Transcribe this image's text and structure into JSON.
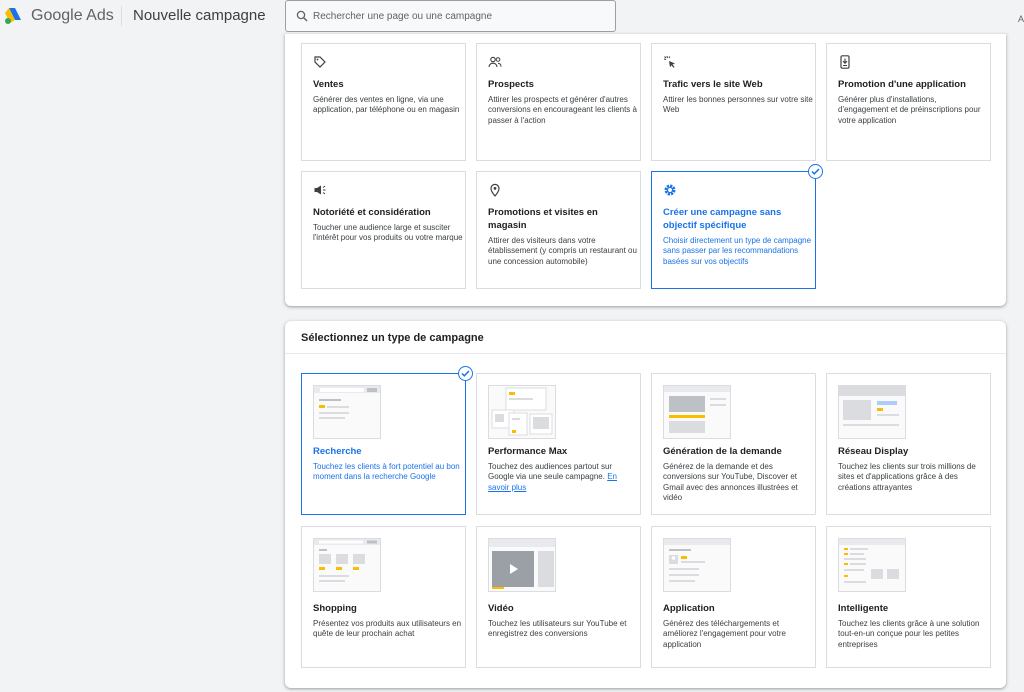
{
  "header": {
    "brand": "Google Ads",
    "page_title": "Nouvelle campagne",
    "search_placeholder": "Rechercher une page ou une campagne",
    "corner_letter": "A"
  },
  "objectives": [
    {
      "icon": "tag-icon",
      "title": "Ventes",
      "desc": "Générer des ventes en ligne, via une application, par téléphone ou en magasin",
      "selected": false
    },
    {
      "icon": "people-icon",
      "title": "Prospects",
      "desc": "Attirer les prospects et générer d'autres conversions en encourageant les clients à passer à l'action",
      "selected": false
    },
    {
      "icon": "cursor-click-icon",
      "title": "Trafic vers le site Web",
      "desc": "Attirer les bonnes personnes sur votre site Web",
      "selected": false
    },
    {
      "icon": "phone-download-icon",
      "title": "Promotion d'une application",
      "desc": "Générer plus d'installations, d'engagement et de préinscriptions pour votre application",
      "selected": false
    },
    {
      "icon": "megaphone-icon",
      "title": "Notoriété et considération",
      "desc": "Toucher une audience large et susciter l'intérêt pour vos produits ou votre marque",
      "selected": false
    },
    {
      "icon": "location-pin-icon",
      "title": "Promotions et visites en magasin",
      "desc": "Attirer des visiteurs dans votre établissement (y compris un restaurant ou une concession automobile)",
      "selected": false
    },
    {
      "icon": "gear-icon",
      "title": "Créer une campagne sans objectif spécifique",
      "desc": "Choisir directement un type de campagne sans passer par les recommandations basées sur vos objectifs",
      "selected": true
    }
  ],
  "campaign_types": {
    "heading": "Sélectionnez un type de campagne",
    "items": [
      {
        "thumb": "search-thumbnail",
        "title": "Recherche",
        "desc": "Touchez les clients à fort potentiel au bon moment dans la recherche Google",
        "selected": true
      },
      {
        "thumb": "performance-max-thumbnail",
        "title": "Performance Max",
        "desc": "Touchez des audiences partout sur Google via une seule campagne.",
        "link": "En savoir plus",
        "selected": false
      },
      {
        "thumb": "demand-gen-thumbnail",
        "title": "Génération de la demande",
        "desc": "Générez de la demande et des conversions sur YouTube, Discover et Gmail avec des annonces illustrées et vidéo",
        "selected": false
      },
      {
        "thumb": "display-thumbnail",
        "title": "Réseau Display",
        "desc": "Touchez les clients sur trois millions de sites et d'applications grâce à des créations attrayantes",
        "selected": false
      },
      {
        "thumb": "shopping-thumbnail",
        "title": "Shopping",
        "desc": "Présentez vos produits aux utilisateurs en quête de leur prochain achat",
        "selected": false
      },
      {
        "thumb": "video-thumbnail",
        "title": "Vidéo",
        "desc": "Touchez les utilisateurs sur YouTube et enregistrez des conversions",
        "selected": false
      },
      {
        "thumb": "app-thumbnail",
        "title": "Application",
        "desc": "Générez des téléchargements et améliorez l'engagement pour votre application",
        "selected": false
      },
      {
        "thumb": "smart-thumbnail",
        "title": "Intelligente",
        "desc": "Touchez les clients grâce à une solution tout-en-un conçue pour les petites entreprises",
        "selected": false
      }
    ]
  },
  "colors": {
    "accent": "#1a73e8",
    "highlight": "#fbbc04",
    "border": "#dadce0"
  }
}
